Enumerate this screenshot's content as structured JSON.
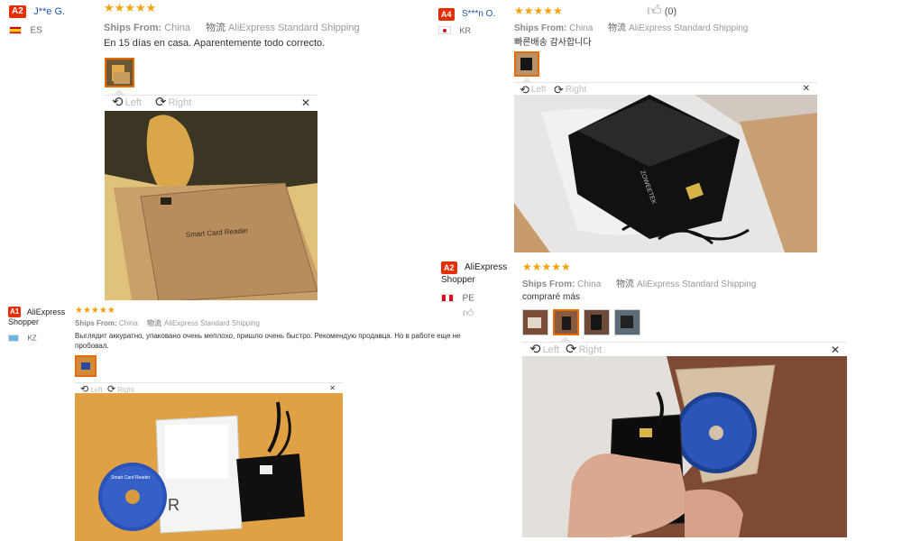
{
  "reviews": [
    {
      "badge": "A2",
      "name": "J**e G.",
      "country": "ES",
      "stars": "★★★★★",
      "ships_label": "Ships From:",
      "ships_from": "China",
      "shipping_cn": "物流",
      "shipping": "AliExpress Standard Shipping",
      "text": "En 15 días en casa. Aparentemente todo correcto.",
      "rotate_left": "Left",
      "rotate_right": "Right",
      "close": "✕"
    },
    {
      "badge": "A4",
      "name": "S***n O.",
      "country": "KR",
      "stars": "★★★★★",
      "helpful_count": "(0)",
      "ships_label": "Ships From:",
      "ships_from": "China",
      "shipping_cn": "物流",
      "shipping": "AliExpress Standard Shipping",
      "text": "빠른배송 감사합니다",
      "rotate_left": "Left",
      "rotate_right": "Right",
      "close": "✕"
    },
    {
      "badge": "A1",
      "name": "AliExpress Shopper",
      "country": "KZ",
      "stars": "★★★★★",
      "ships_label": "Ships From:",
      "ships_from": "China",
      "shipping_cn": "物流",
      "shipping": "AliExpress Standard Shipping",
      "text": "Выглядит аккуратно, упаковано очень меплохо, пришло очень быстро. Рекомендую продавца. Но в работе еще не пробовал.",
      "rotate_left": "Left",
      "rotate_right": "Right",
      "close": "✕"
    },
    {
      "badge": "A2",
      "name": "AliExpress Shopper",
      "country": "PE",
      "stars": "★★★★★",
      "ships_label": "Ships From:",
      "ships_from": "China",
      "shipping_cn": "物流",
      "shipping": "AliExpress Standard Shipping",
      "text": "compraré más",
      "rotate_left": "Left",
      "rotate_right": "Right",
      "close": "✕"
    }
  ],
  "photo_labels": {
    "box_label": "Smart Card Reader",
    "cd_label": "Smart Card Reader",
    "r_mark": "R",
    "brand": "ZOWEETEK"
  },
  "colors": {
    "accent": "#e62e04",
    "star": "#f7a10a",
    "selected_thumb": "#e86b00"
  }
}
